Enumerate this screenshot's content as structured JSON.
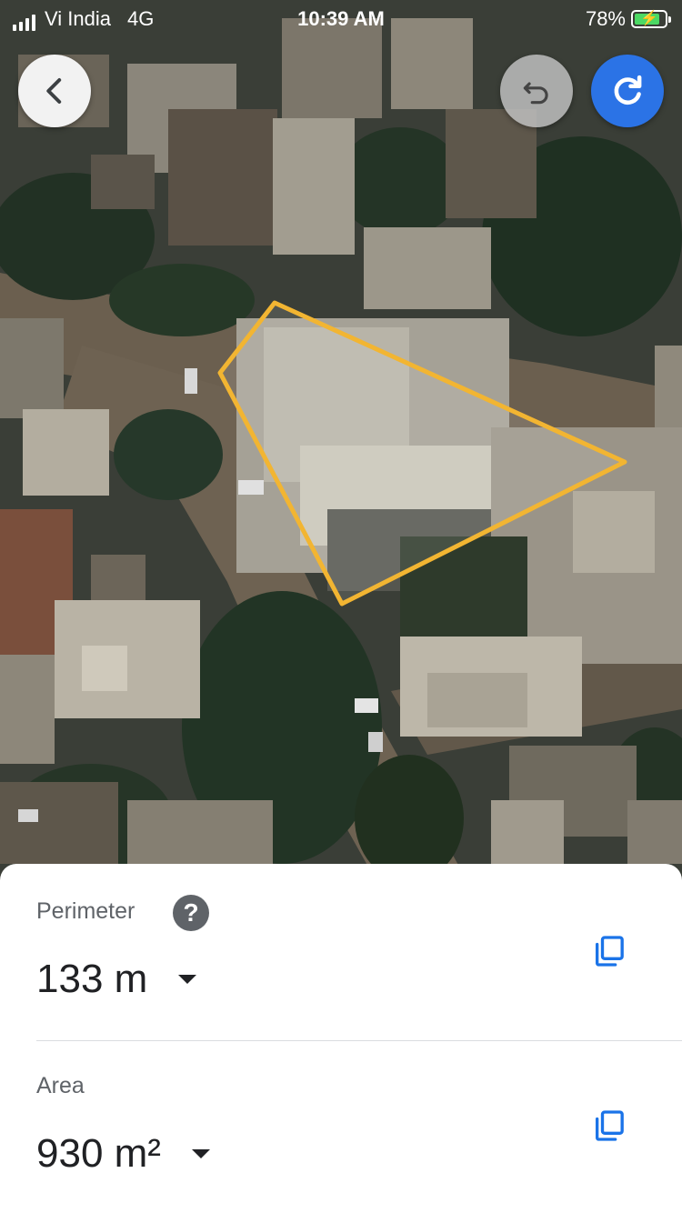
{
  "status_bar": {
    "carrier": "Vi India",
    "network": "4G",
    "time": "10:39 AM",
    "battery": "78%",
    "battery_level": 0.78
  },
  "toolbar": {
    "back_icon": "chevron-left-icon",
    "undo_icon": "undo-icon",
    "redo_icon": "redo-icon",
    "redo_color": "#2b73e6"
  },
  "map": {
    "type": "satellite",
    "measure_outline_color": "#f2b532"
  },
  "measurement": {
    "perimeter": {
      "label": "Perimeter",
      "value": "133 m",
      "help_icon": "help-icon",
      "copy_icon": "copy-icon"
    },
    "area": {
      "label": "Area",
      "value": "930 m²",
      "copy_icon": "copy-icon"
    },
    "accent_color": "#1a73e8"
  }
}
